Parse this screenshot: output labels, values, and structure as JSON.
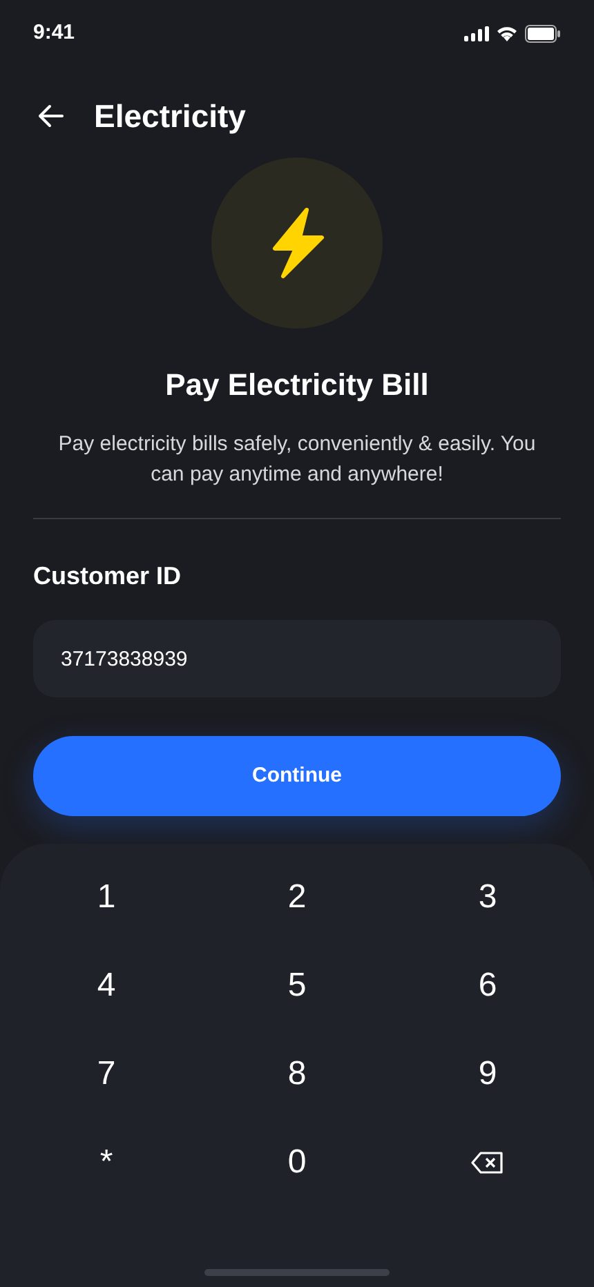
{
  "status_bar": {
    "time": "9:41"
  },
  "header": {
    "title": "Electricity"
  },
  "hero": {
    "title": "Pay Electricity Bill",
    "description": "Pay electricity bills safely, conveniently & easily. You can pay anytime and anywhere!"
  },
  "form": {
    "label": "Customer ID",
    "value": "37173838939"
  },
  "continue_button": {
    "label": "Continue"
  },
  "keypad": [
    {
      "kind": "char",
      "label": "1"
    },
    {
      "kind": "char",
      "label": "2"
    },
    {
      "kind": "char",
      "label": "3"
    },
    {
      "kind": "char",
      "label": "4"
    },
    {
      "kind": "char",
      "label": "5"
    },
    {
      "kind": "char",
      "label": "6"
    },
    {
      "kind": "char",
      "label": "7"
    },
    {
      "kind": "char",
      "label": "8"
    },
    {
      "kind": "char",
      "label": "9"
    },
    {
      "kind": "char",
      "label": "*"
    },
    {
      "kind": "char",
      "label": "0"
    },
    {
      "kind": "backspace"
    }
  ]
}
